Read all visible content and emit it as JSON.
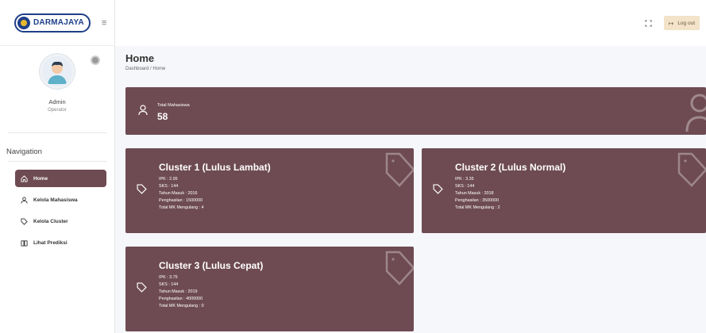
{
  "brand": {
    "name": "DARMAJAYA"
  },
  "profile": {
    "name": "Admin",
    "role": "Operator"
  },
  "navigation": {
    "heading": "Navigation",
    "items": [
      {
        "label": "Home",
        "icon": "home-icon",
        "active": true
      },
      {
        "label": "Kelola Mahasiswa",
        "icon": "user-icon",
        "active": false
      },
      {
        "label": "Kelola Cluster",
        "icon": "tag-icon",
        "active": false
      },
      {
        "label": "Lihat Prediksi",
        "icon": "book-icon",
        "active": false
      }
    ]
  },
  "topbar": {
    "logout_label": "Log out"
  },
  "page": {
    "title": "Home",
    "breadcrumb": "Dashboard / Home"
  },
  "summary": {
    "label": "Total Mahasiswa",
    "value": "58"
  },
  "clusters": [
    {
      "title": "Cluster 1 (Lulus Lambat)",
      "ipk": "IPK : 2.95",
      "sks": "SKS : 144",
      "tahun": "Tahun Masuk : 2016",
      "penghasilan": "Penghasilan : 1500000",
      "mk": "Total MK Mengulang : 4"
    },
    {
      "title": "Cluster 2 (Lulus Normal)",
      "ipk": "IPK : 3.35",
      "sks": "SKS : 144",
      "tahun": "Tahun Masuk : 2018",
      "penghasilan": "Penghasilan : 3500000",
      "mk": "Total MK Mengulang : 2"
    },
    {
      "title": "Cluster 3 (Lulus Cepat)",
      "ipk": "IPK : 3.75",
      "sks": "SKS : 144",
      "tahun": "Tahun Masuk : 2019",
      "penghasilan": "Penghasilan : 4000000",
      "mk": "Total MK Mengulang : 0"
    }
  ],
  "colors": {
    "card": "#6e4b53",
    "logout_bg": "#f2e3c9",
    "brand": "#1f3f88"
  }
}
